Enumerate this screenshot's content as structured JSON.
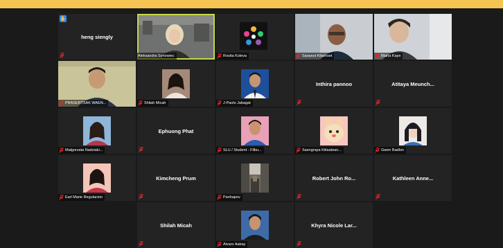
{
  "window": {
    "accent_color": "#f6c453",
    "active_speaker_color": "#c3d94a",
    "mute_color": "#e02828"
  },
  "participants": [
    {
      "name": "heng siengly",
      "show_name_center": true,
      "label": "",
      "raised_hand": true,
      "hand_icon": "hand-icon"
    },
    {
      "name": "Aleksandra Synowiec",
      "label": "Aleksandra Synowiec",
      "video": "portrait-blonde"
    },
    {
      "name": "Rosita Koleva",
      "label": "Rosita Koleva",
      "video": "logo-colorful"
    },
    {
      "name": "Sarawut Khamset",
      "label": "Sarawut Khamset",
      "video": "portrait-glasses"
    },
    {
      "name": "Riana Kaye",
      "label": "Riana Kaye",
      "video": "portrait-room"
    },
    {
      "name": "PRASERTSAK WAEN...",
      "label": "PRASERTSAK WAEN...",
      "video": "portrait-man-green"
    },
    {
      "name": "Shilah Micah",
      "label": "Shilah Micah",
      "video": "portrait-woman"
    },
    {
      "name": "J-Paolo Jabagat",
      "label": "J-Paolo Jabagat",
      "video": "portrait-man-blue"
    },
    {
      "name": "Inthira pannoo",
      "show_name_center": true,
      "label": ""
    },
    {
      "name": "Atitaya Meunch...",
      "show_name_center": true,
      "label": ""
    },
    {
      "name": "Małgorzata Nadziaki...",
      "label": "Małgorzata Nadziaki...",
      "video": "portrait-woman-dark"
    },
    {
      "name": "Ephuong Phat",
      "show_name_center": true,
      "label": ""
    },
    {
      "name": "SLU / Student - Filbu...",
      "label": "SLU / Student - Filbu...",
      "video": "portrait-man-pink"
    },
    {
      "name": "Saengraya Kitisatean...",
      "label": "Saengraya Kitisatean...",
      "video": "cartoon-rabbit"
    },
    {
      "name": "Gwen Badlon",
      "label": "Gwen Badlon",
      "video": "portrait-anime"
    },
    {
      "name": "Earl Marie Regulacion",
      "label": "Earl Marie Regulacion",
      "video": "portrait-woman-red"
    },
    {
      "name": "Kimcheng Prum",
      "show_name_center": true,
      "label": ""
    },
    {
      "name": "Panhapov",
      "label": "Panhapov",
      "video": "street-scene"
    },
    {
      "name": "Robert John Ro...",
      "show_name_center": true,
      "label": ""
    },
    {
      "name": "Kathleen Anne...",
      "show_name_center": true,
      "label": ""
    },
    {
      "name": "Shilah Micah",
      "show_name_center": true,
      "label": ""
    },
    {
      "name": "Alvaro Aabay",
      "label": "Alvaro Aabay",
      "video": "portrait-man-blue2"
    },
    {
      "name": "Khyra Nicole Lar...",
      "show_name_center": true,
      "label": ""
    }
  ]
}
